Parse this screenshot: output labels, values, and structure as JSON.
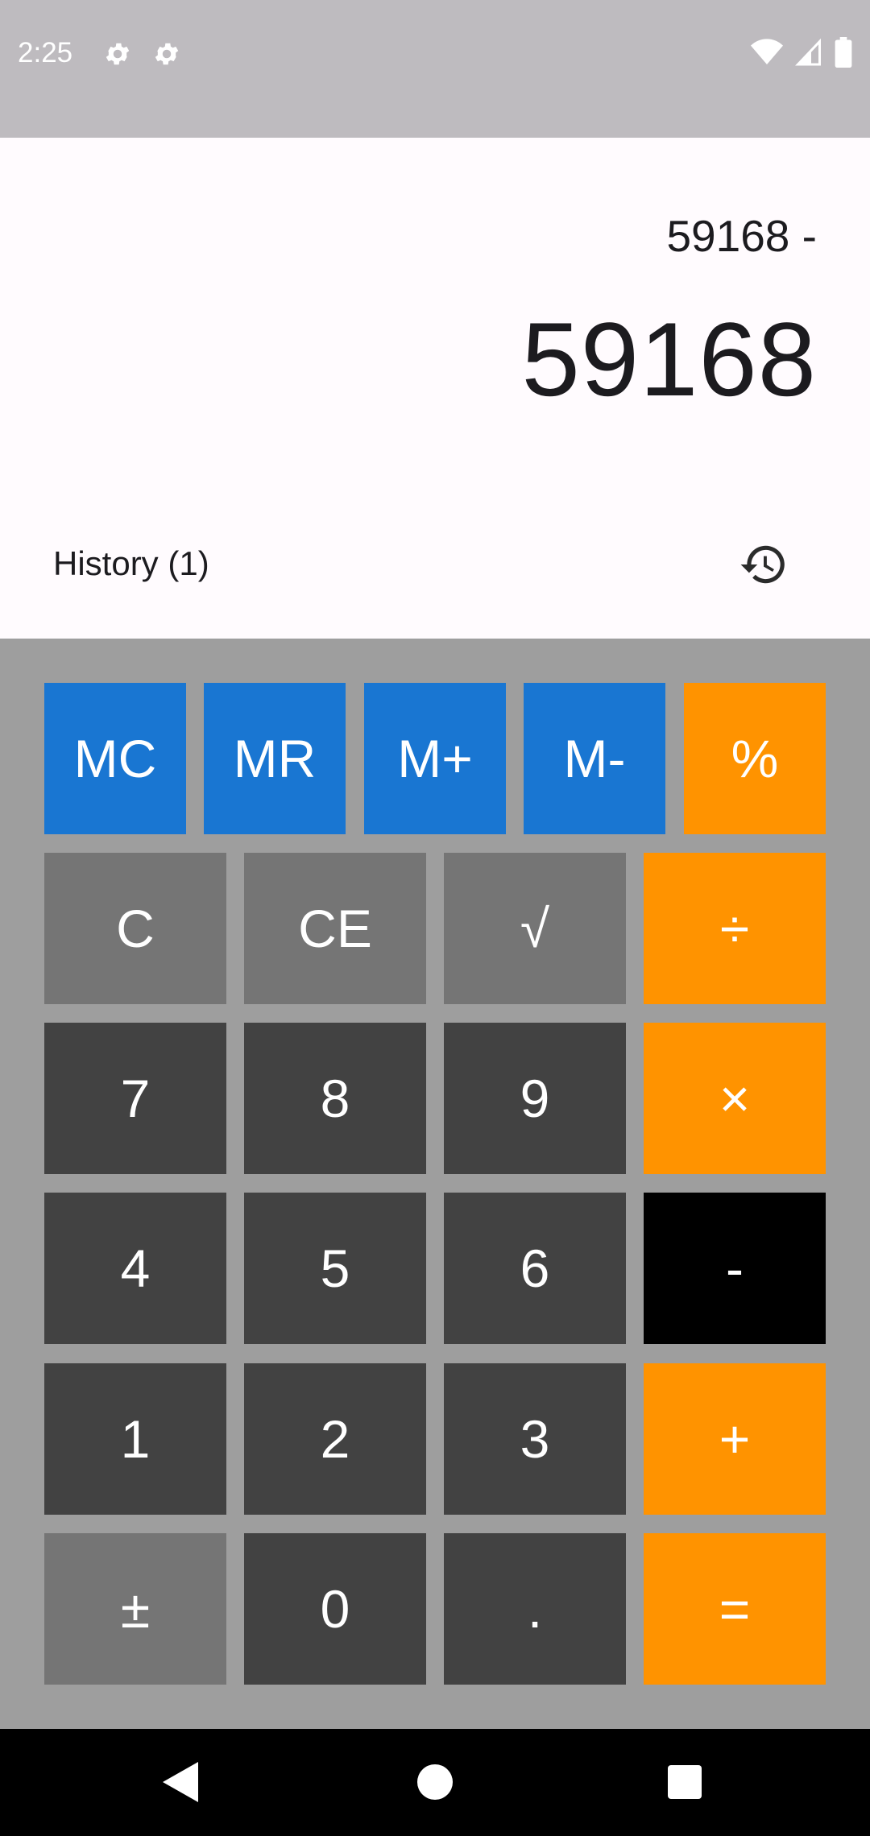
{
  "status_bar": {
    "time": "2:25",
    "left_icons": [
      "gear-icon",
      "gear-icon"
    ],
    "right_icons": [
      "wifi-icon",
      "cellular-signal-icon",
      "battery-icon"
    ]
  },
  "display": {
    "expression": "59168 -",
    "result": "59168"
  },
  "history": {
    "label": "History (1)",
    "icon": "history-icon"
  },
  "keypad": {
    "memory_row": [
      {
        "label": "MC",
        "name": "memory-clear-button"
      },
      {
        "label": "MR",
        "name": "memory-recall-button"
      },
      {
        "label": "M+",
        "name": "memory-add-button"
      },
      {
        "label": "M-",
        "name": "memory-subtract-button"
      },
      {
        "label": "%",
        "name": "percent-button"
      }
    ],
    "rows": [
      [
        {
          "label": "C",
          "name": "clear-button"
        },
        {
          "label": "CE",
          "name": "clear-entry-button"
        },
        {
          "label": "√",
          "name": "square-root-button"
        },
        {
          "label": "÷",
          "name": "divide-button"
        }
      ],
      [
        {
          "label": "7",
          "name": "digit-7-button"
        },
        {
          "label": "8",
          "name": "digit-8-button"
        },
        {
          "label": "9",
          "name": "digit-9-button"
        },
        {
          "label": "×",
          "name": "multiply-button"
        }
      ],
      [
        {
          "label": "4",
          "name": "digit-4-button"
        },
        {
          "label": "5",
          "name": "digit-5-button"
        },
        {
          "label": "6",
          "name": "digit-6-button"
        },
        {
          "label": "-",
          "name": "subtract-button"
        }
      ],
      [
        {
          "label": "1",
          "name": "digit-1-button"
        },
        {
          "label": "2",
          "name": "digit-2-button"
        },
        {
          "label": "3",
          "name": "digit-3-button"
        },
        {
          "label": "+",
          "name": "add-button"
        }
      ],
      [
        {
          "label": "±",
          "name": "sign-toggle-button"
        },
        {
          "label": "0",
          "name": "digit-0-button"
        },
        {
          "label": ".",
          "name": "decimal-point-button"
        },
        {
          "label": "=",
          "name": "equals-button"
        }
      ]
    ]
  },
  "colors": {
    "memory_key": "#1976d2",
    "operator_key": "#ff9300",
    "function_key": "#757575",
    "digit_key": "#424242",
    "active_operator_key": "#000000",
    "keypad_background": "#9e9e9e",
    "status_bar": "#bebbbf",
    "display_background": "#fffbfe"
  },
  "nav_bar": {
    "icons": [
      "back-icon",
      "home-icon",
      "recents-icon"
    ]
  }
}
